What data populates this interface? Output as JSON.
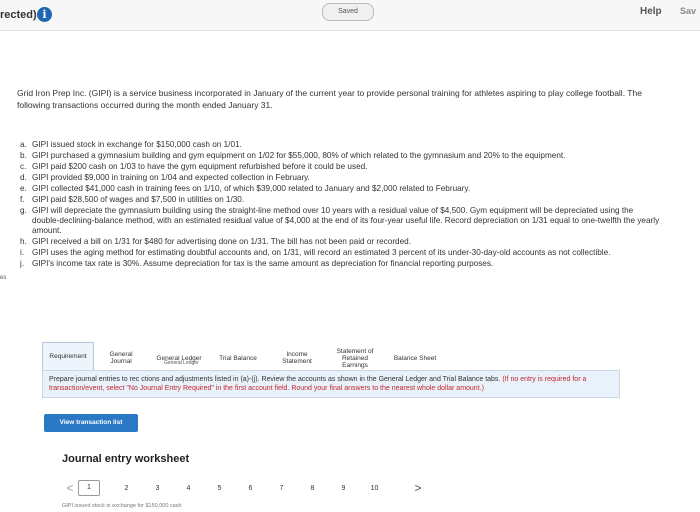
{
  "header": {
    "title": "rected)",
    "info_icon_glyph": "i",
    "saved": "Saved",
    "help": "Help",
    "save_exit": "Sav"
  },
  "side_tab": "es",
  "intro": "Grid Iron Prep Inc. (GIPI) is a service business incorporated in January of the current year to provide personal training for athletes aspiring to play college football. The following transactions occurred during the month ended January 31.",
  "transactions": [
    {
      "letter": "a.",
      "text": "GIPI issued stock in exchange for $150,000 cash on 1/01."
    },
    {
      "letter": "b.",
      "text": "GIPI purchased a gymnasium building and gym equipment on 1/02 for $55,000, 80% of which related to the gymnasium and 20% to the equipment."
    },
    {
      "letter": "c.",
      "text": "GIPI paid $200 cash on 1/03 to have the gym equipment refurbished before it could be used."
    },
    {
      "letter": "d.",
      "text": "GIPI provided $9,000 in training on 1/04 and expected collection in February."
    },
    {
      "letter": "e.",
      "text": "GIPI collected $41,000 cash in training fees on 1/10, of which $39,000 related to January and $2,000 related to February."
    },
    {
      "letter": "f.",
      "text": "GIPI paid $28,500 of wages and $7,500 in utilities on 1/30."
    },
    {
      "letter": "g.",
      "text": "GIPI will depreciate the gymnasium building using the straight-line method over 10 years with a residual value of $4,500. Gym equipment will be depreciated using the double-declining-balance method, with an estimated residual value of $4,000 at the end of its four-year useful life. Record depreciation on 1/31 equal to one-twelfth the yearly amount."
    },
    {
      "letter": "h.",
      "text": "GIPI received a bill on 1/31 for $480 for advertising done on 1/31. The bill has not been paid or recorded."
    },
    {
      "letter": "i.",
      "text": "GIPI uses the aging method for estimating doubtful accounts and, on 1/31, will record an estimated 3 percent of its under-30-day-old accounts as not collectible."
    },
    {
      "letter": "j.",
      "text": "GIPI's income tax rate is 30%. Assume depreciation for tax is the same amount as depreciation for financial reporting purposes."
    }
  ],
  "tabs": [
    {
      "label": "Requirement"
    },
    {
      "label": "General Journal"
    },
    {
      "label": "General Ledger"
    },
    {
      "label": "Trial Balance"
    },
    {
      "label": "Income Statement"
    },
    {
      "label": "Statement of Retained Earnings"
    },
    {
      "label": "Balance Sheet"
    }
  ],
  "tooltip": "General Ledger",
  "instructions": {
    "part1": "Prepare journal entries to rec",
    "part2": "ctions and adjustments listed in (a)-(j). Review the accounts as shown in the General Ledger and Trial Balance tabs.",
    "red": "(If no entry is required for a transaction/event, select \"No Journal Entry Required\" in the first account field. Round your final answers to the nearest whole dollar amount.)"
  },
  "view_button": "View transaction list",
  "worksheet": {
    "title": "Journal entry worksheet",
    "pages": [
      "1",
      "2",
      "3",
      "4",
      "5",
      "6",
      "7",
      "8",
      "9",
      "10"
    ],
    "active_page": "1",
    "prev": "<",
    "next": ">",
    "entry_preview": "GIPI issued stock in exchange for $150,000 cash"
  },
  "colors": {
    "info_icon": "#1f67b3",
    "button": "#2a78c4",
    "panel": "#e9f1fa",
    "warning_text": "#c2272d"
  }
}
